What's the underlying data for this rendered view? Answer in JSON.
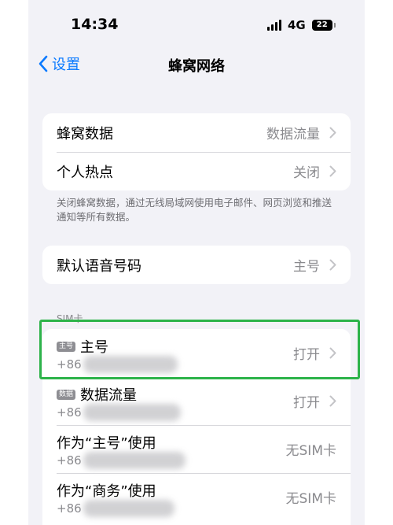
{
  "status": {
    "time": "14:34",
    "network": "4G",
    "battery": "22"
  },
  "nav": {
    "back_label": "设置",
    "title": "蜂窝网络"
  },
  "group1": [
    {
      "label": "蜂窝数据",
      "value": "数据流量"
    },
    {
      "label": "个人热点",
      "value": "关闭"
    }
  ],
  "footer_note": "关闭蜂窝数据，通过无线局域网使用电子邮件、网页浏览和推送通知等所有数据。",
  "group2": [
    {
      "label": "默认语音号码",
      "value": "主号"
    }
  ],
  "sim_section_header": "SIM卡",
  "sim_rows": [
    {
      "badge": "主号",
      "name": "主号",
      "number": "+86",
      "value": "打开"
    },
    {
      "badge": "数据",
      "name": "数据流量",
      "number": "+86",
      "value": "打开"
    },
    {
      "badge": "",
      "name": "作为“主号”使用",
      "number": "+86",
      "value": "无SIM卡"
    },
    {
      "badge": "",
      "name": "作为“商务”使用",
      "number": "+86",
      "value": "无SIM卡"
    }
  ],
  "colors": {
    "accent": "#0a7aff",
    "highlight": "#2db34a",
    "background": "#f2f2f7"
  }
}
